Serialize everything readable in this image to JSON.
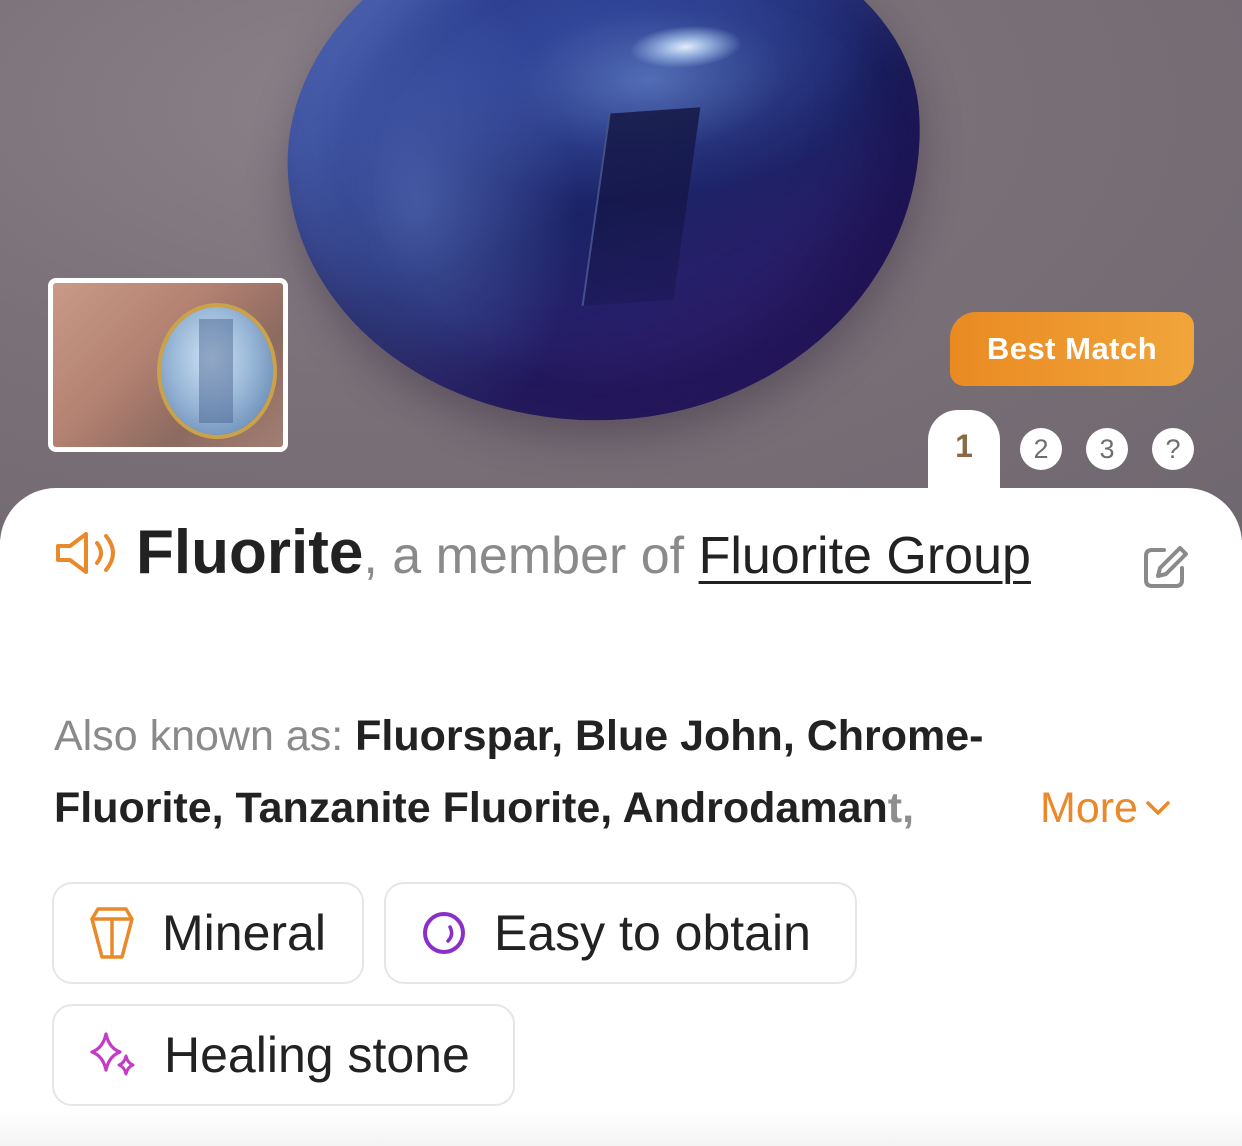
{
  "hero": {
    "badge": "Best Match",
    "pages": [
      "1",
      "2",
      "3",
      "?"
    ],
    "active_page": "1"
  },
  "title": {
    "name": "Fluorite",
    "connector": ", a member of ",
    "group": "Fluorite Group"
  },
  "aka": {
    "label": "Also known as: ",
    "names": "Fluorspar, Blue John, Chrome-Fluorite, Tanzanite Fluorite, Androdaman",
    "faded": "t,",
    "more": "More"
  },
  "tags": {
    "mineral": "Mineral",
    "obtain": "Easy to obtain",
    "healing": "Healing stone"
  },
  "colors": {
    "accent": "#e9892a",
    "badge_start": "#ea8a22",
    "badge_end": "#f0a53a",
    "text": "#222222",
    "muted": "#8a8a8a",
    "obtain_icon": "#8a2fc9",
    "healing_icon": "#c43bc8"
  },
  "icons": [
    "speaker-icon",
    "edit-icon",
    "chevron-down-icon",
    "crystal-icon",
    "ring-icon",
    "sparkle-icon"
  ]
}
